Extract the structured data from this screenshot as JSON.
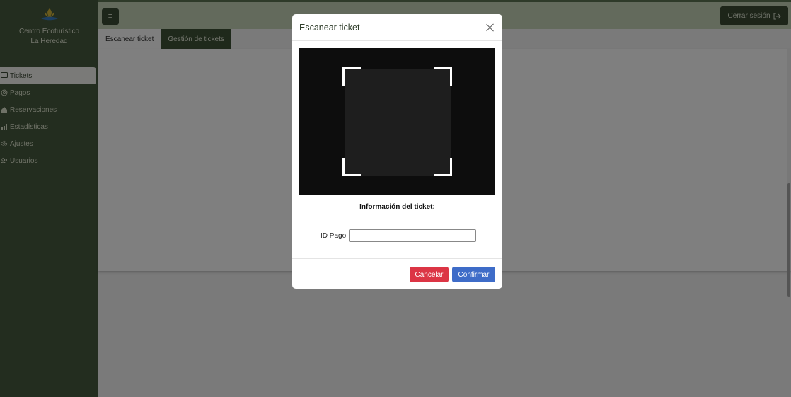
{
  "brand": {
    "line1": "Centro Ecoturístico",
    "line2": "La Heredad"
  },
  "sidebar": {
    "items": [
      {
        "label": "Tickets",
        "icon": "ticket-icon",
        "active": true
      },
      {
        "label": "Pagos",
        "icon": "coins-icon"
      },
      {
        "label": "Reservaciones",
        "icon": "house-icon"
      },
      {
        "label": "Estadísticas",
        "icon": "bar-chart-icon"
      },
      {
        "label": "Ajustes",
        "icon": "gear-icon"
      },
      {
        "label": "Usuarios",
        "icon": "users-icon"
      }
    ]
  },
  "topbar": {
    "menu_icon": "≡",
    "logout_label": "Cerrar sesión"
  },
  "tabs": [
    {
      "label": "Escanear ticket",
      "active": false
    },
    {
      "label": "Gestión de tickets",
      "active": true
    }
  ],
  "modal": {
    "title": "Escanear ticket",
    "info_title": "Información del ticket:",
    "id_label": "ID Pago",
    "id_value": "",
    "cancel_label": "Cancelar",
    "confirm_label": "Confirmar"
  },
  "colors": {
    "sidebar": "#465a3f",
    "accent_dark": "#3a4b33",
    "danger": "#dc3545",
    "primary": "#3e6cc8"
  }
}
